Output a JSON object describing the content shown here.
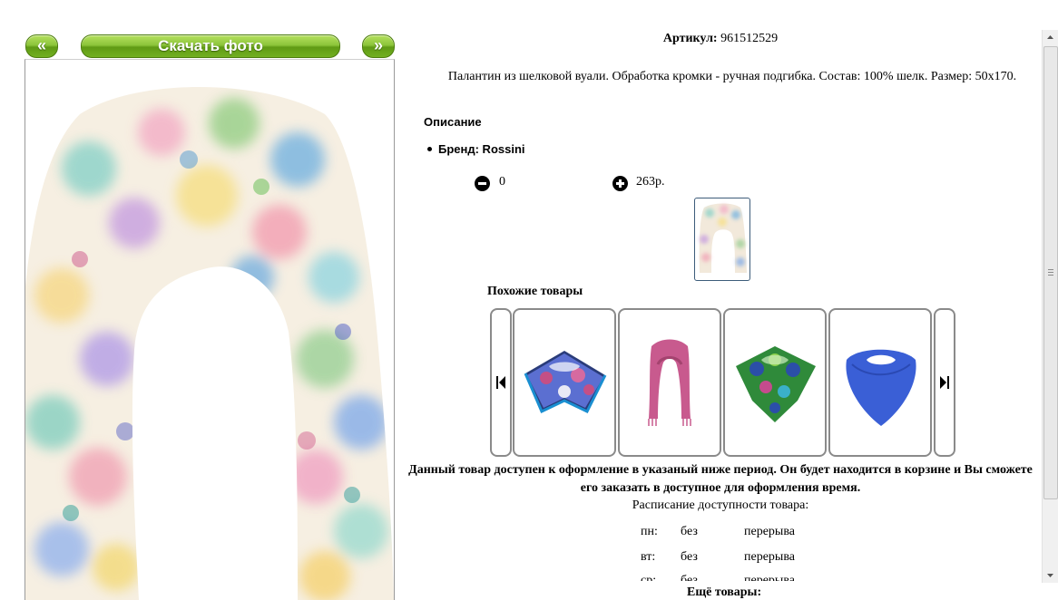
{
  "gallery": {
    "prev_label": "«",
    "download_label": "Скачать фото",
    "next_label": "»"
  },
  "product": {
    "sku_label": "Артикул:",
    "sku_value": "961512529",
    "description": "Палантин из шелковой вуали. Обработка кромки - ручная подгибка. Состав: 100% шелк. Размер: 50x170.",
    "section_title": "Описание",
    "brand": "Бренд: Rossini",
    "quantity": "0",
    "price": "263р."
  },
  "similar": {
    "title": "Похожие товары"
  },
  "availability": {
    "notice": "Данный товар доступен к оформление в указаный ниже период. Он будет находится в корзине и Вы сможете его заказать в доступное для оформления время.",
    "schedule_title": "Расписание доступности товара:",
    "rows": [
      {
        "day": "пн:",
        "from": "без",
        "to": "перерыва"
      },
      {
        "day": "вт:",
        "from": "без",
        "to": "перерыва"
      },
      {
        "day": "ср:",
        "from": "без",
        "to": "перерыва"
      }
    ]
  },
  "more_label": "Ещё товары:",
  "colors": {
    "button_green": "#8cc43a",
    "thumb_border": "#3d5c7a",
    "card_border": "#8a8a8a"
  }
}
